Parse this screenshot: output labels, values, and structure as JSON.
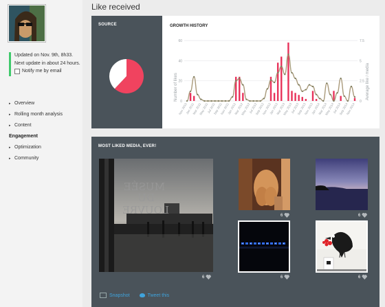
{
  "page": {
    "title": "Like received"
  },
  "sidebar": {
    "status": {
      "updated": "Updated on Nov. 9th, 8h33.",
      "next": "Next update in about 24 hours.",
      "notify": "Notify me by email"
    },
    "nav": [
      {
        "label": "Overview",
        "arrow": true
      },
      {
        "label": "Rolling month analysis",
        "arrow": true
      },
      {
        "label": "Content",
        "arrow": true
      },
      {
        "label": "Engagement",
        "arrow": false,
        "active": true
      },
      {
        "label": "Optimization",
        "arrow": true
      },
      {
        "label": "Community",
        "arrow": true
      }
    ]
  },
  "source": {
    "title": "SOURCE",
    "slices": [
      0.38,
      0.62
    ],
    "colors": [
      "#ffffff",
      "#f0435f"
    ]
  },
  "growth": {
    "title": "GROWTH HISTORY",
    "ylabel_left": "Number of likes",
    "ylabel_right": "Average like / media",
    "left_ticks": [
      "60",
      "40",
      "20",
      "0"
    ],
    "right_ticks": [
      "7.5",
      "5",
      "2.5",
      "0"
    ],
    "x_labels": [
      "Nov 2010",
      "Dec 2010",
      "Jan 2011",
      "Feb 2011",
      "Mar 2011",
      "Apr 2011",
      "May 2011",
      "Jun 2011",
      "Jul 2011",
      "Aug 2011",
      "Sep 2011",
      "Oct 2011",
      "Nov 2011",
      "Dec 2011",
      "Jan 2012",
      "Feb 2012",
      "Mar 2012",
      "Apr 2012",
      "May 2012",
      "Jun 2012",
      "Jul 2012",
      "Aug 2012",
      "Sep 2012",
      "Oct 2012",
      "Nov 2012",
      "Dec 2012",
      "Jan 2013",
      "Feb 2013",
      "Mar 2013",
      "Apr 2013",
      "May 2013",
      "Jun 2013",
      "Jul 2013",
      "Aug 2013",
      "Sep 2013",
      "Oct 2013",
      "Nov 2013",
      "Dec 2013",
      "Jan 2014",
      "Feb 2014",
      "Mar 2014",
      "Apr 2014",
      "May 2014",
      "Jun 2014",
      "Jul 2014",
      "Aug 2014",
      "Sep 2014",
      "Oct 2014",
      "Nov 2014"
    ]
  },
  "chart_data": {
    "type": "bar",
    "categories": [
      "Nov 2010",
      "Dec 2010",
      "Jan 2011",
      "Feb 2011",
      "Mar 2011",
      "Apr 2011",
      "May 2011",
      "Jun 2011",
      "Jul 2011",
      "Aug 2011",
      "Sep 2011",
      "Oct 2011",
      "Nov 2011",
      "Dec 2011",
      "Jan 2012",
      "Feb 2012",
      "Mar 2012",
      "Apr 2012",
      "May 2012",
      "Jun 2012",
      "Jul 2012",
      "Aug 2012",
      "Sep 2012",
      "Oct 2012",
      "Nov 2012",
      "Dec 2012",
      "Jan 2013",
      "Feb 2013",
      "Mar 2013",
      "Apr 2013",
      "May 2013",
      "Jun 2013",
      "Jul 2013",
      "Aug 2013",
      "Sep 2013",
      "Oct 2013",
      "Nov 2013",
      "Dec 2013",
      "Jan 2014",
      "Feb 2014",
      "Mar 2014",
      "Apr 2014",
      "May 2014",
      "Jun 2014",
      "Jul 2014",
      "Aug 2014",
      "Sep 2014",
      "Oct 2014",
      "Nov 2014"
    ],
    "series": [
      {
        "name": "Number of likes",
        "axis": "left",
        "kind": "bar",
        "color": "#e8325a",
        "values": [
          0,
          8,
          5,
          0,
          0,
          0,
          0,
          0,
          0,
          0,
          0,
          0,
          0,
          0,
          24,
          24,
          8,
          0,
          0,
          0,
          0,
          0,
          0,
          0,
          24,
          8,
          38,
          44,
          0,
          58,
          10,
          8,
          6,
          4,
          2,
          0,
          10,
          2,
          0,
          0,
          0,
          0,
          10,
          0,
          5,
          0,
          0,
          0,
          3
        ]
      },
      {
        "name": "Average like / media",
        "axis": "right",
        "kind": "line",
        "color": "#a9997a",
        "values": [
          0,
          1.2,
          3.0,
          0.8,
          0.2,
          0,
          0,
          0,
          0,
          0,
          0,
          0,
          0,
          0.5,
          2.5,
          2.8,
          2.0,
          0.2,
          0,
          0,
          0,
          0,
          0.3,
          1.5,
          2.6,
          2.3,
          3.5,
          4.3,
          3.3,
          5.8,
          3.5,
          2.8,
          2.0,
          1.2,
          1.4,
          2.0,
          1.8,
          0.8,
          0.3,
          0,
          2.2,
          0.8,
          0,
          1.0,
          2.8,
          0.6,
          0,
          1.8,
          0.5
        ]
      }
    ],
    "ylim_left": [
      0,
      60
    ],
    "ylim_right": [
      0,
      7.5
    ],
    "legend": "none"
  },
  "most_liked": {
    "title": "MOST LIKED MEDIA, EVER!",
    "items": [
      {
        "count": "6",
        "img": "louvre-photo"
      },
      {
        "count": "6",
        "img": "statue-photo"
      },
      {
        "count": "6",
        "img": "sea-photo"
      },
      {
        "count": "6",
        "img": "night-photo"
      },
      {
        "count": "6",
        "img": "bird-photo"
      }
    ],
    "photo_text": [
      "MUSÉE",
      "DU",
      "LOUVRE"
    ],
    "snapshot_label": "Snapshot",
    "tweet_label": "Tweet this"
  }
}
